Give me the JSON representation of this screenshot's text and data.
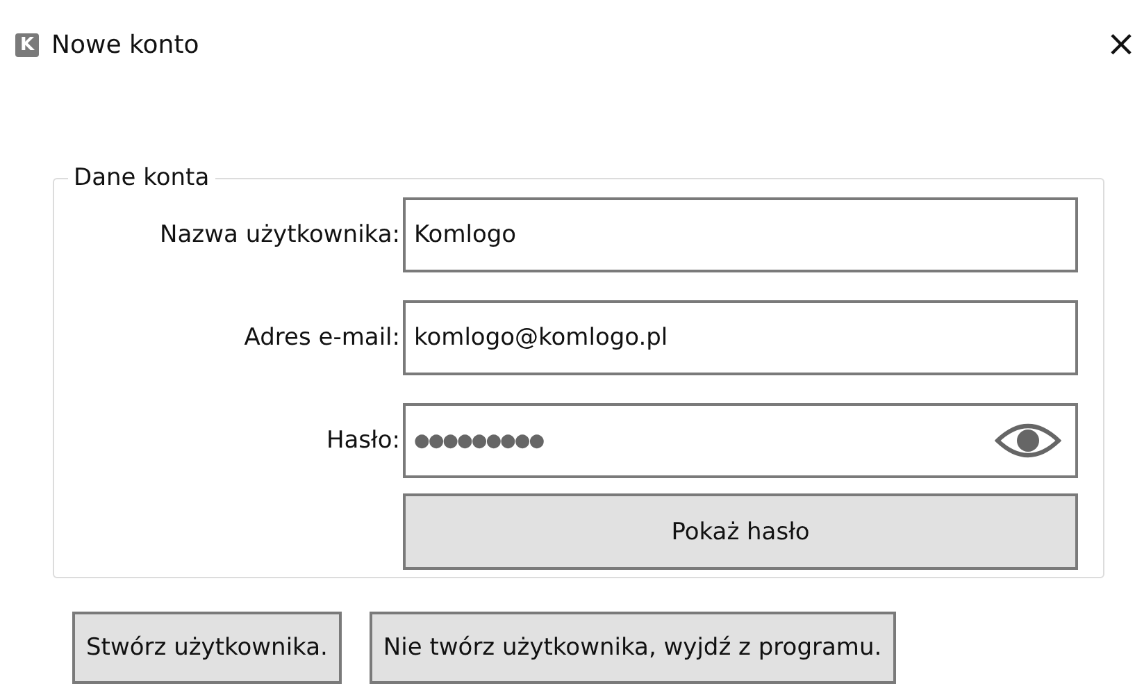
{
  "window": {
    "title": "Nowe konto",
    "icon_letter": "K",
    "close": "×"
  },
  "group": {
    "legend": "Dane konta",
    "fields": [
      {
        "kind": "text",
        "label": "Nazwa użytkownika:",
        "value": "Komlogo"
      },
      {
        "kind": "text",
        "label": "Adres e-mail:",
        "value": "komlogo@komlogo.pl"
      },
      {
        "kind": "password",
        "label": "Hasło:",
        "value": "●●●●●●●●●"
      }
    ],
    "show_password_button": "Pokaż hasło"
  },
  "buttons": [
    "Stwórz użytkownika.",
    "Nie twórz użytkownika, wyjdź z programu."
  ]
}
